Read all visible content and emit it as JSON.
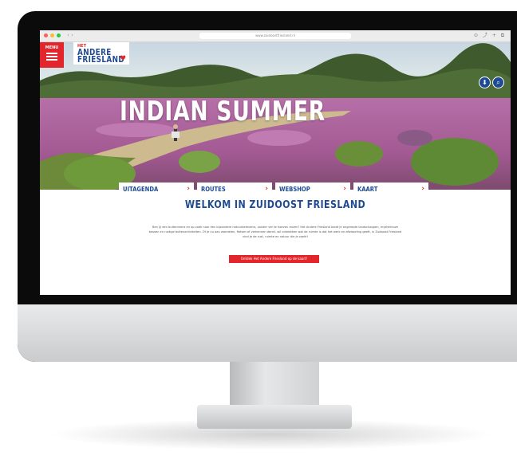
{
  "browser": {
    "url": "www.zuidoostfriesland.nl",
    "toolbar_icons": "⊙ ⤴ + ⧉"
  },
  "header": {
    "menu_label": "MENU",
    "logo_top": "HET",
    "logo_line1": "ANDERE",
    "logo_line2": "FRIESLAND",
    "download_icon": "download-icon",
    "search_icon": "search-icon"
  },
  "hero": {
    "title": "INDIAN SUMMER"
  },
  "nav": {
    "items": [
      {
        "label": "UITAGENDA",
        "arrow": "›"
      },
      {
        "label": "ROUTES",
        "arrow": "›"
      },
      {
        "label": "WEBSHOP",
        "arrow": "›"
      },
      {
        "label": "KAART",
        "arrow": "›"
      }
    ]
  },
  "main": {
    "heading": "WELKOM IN ZUIDOOST FRIESLAND",
    "body": "Ben jij een buitenmens en op zoek naar een bijzondere natuurbelevenis, zonder ver te hoeven reizen? Het Andere Friesland biedt je ongerepte landschappen, mysterieuze bossen en rustige buitenactiviteiten. Of je nu aan wandelen, fietsen of verkennen denkt, wil ontdekken wat de ruimte is dat het werk en afwisseling geeft, in Zuidoost Friesland vind je de rust, ruimte en natuur die je zoekt!",
    "cta": "Ontdek Het Andere Friesland op de kaart!"
  },
  "colors": {
    "brand_red": "#e3262b",
    "brand_blue": "#1e4b93"
  }
}
